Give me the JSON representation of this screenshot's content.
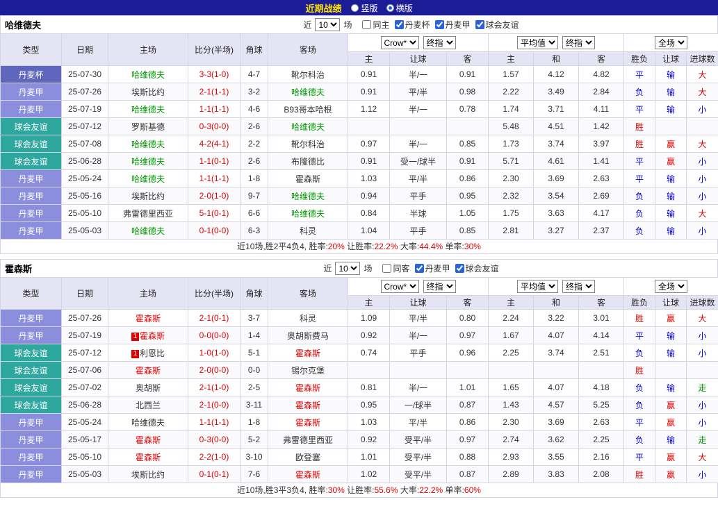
{
  "topbar": {
    "title": "近期战绩",
    "options": [
      {
        "label": "竖版",
        "selected": false
      },
      {
        "label": "横版",
        "selected": true
      }
    ]
  },
  "league_colors": {
    "丹麦杯": "#5F66BE",
    "丹麦甲": "#8A8EDC",
    "球会友谊": "#2EA89F"
  },
  "tables": [
    {
      "team": "哈维德夫",
      "filter": {
        "near_label": "近",
        "count": "10",
        "games_label": "场",
        "checkboxes": [
          {
            "label": "同主",
            "checked": false
          },
          {
            "label": "丹麦杯",
            "checked": true
          },
          {
            "label": "丹麦甲",
            "checked": true
          },
          {
            "label": "球会友谊",
            "checked": true
          }
        ]
      },
      "dropdowns": {
        "bookmaker": "Crow*",
        "bookmaker_stage": "终指",
        "average": "平均值",
        "average_stage": "终指",
        "scope": "全场"
      },
      "columns": [
        "类型",
        "日期",
        "主场",
        "比分(半场)",
        "角球",
        "客场",
        "主",
        "让球",
        "客",
        "主",
        "和",
        "客",
        "胜负",
        "让球",
        "进球数"
      ],
      "rows": [
        {
          "league": "丹麦杯",
          "date": "25-07-30",
          "home": "哈维德夫",
          "home_color": "green",
          "score": "3-3(1-0)",
          "corner": "4-7",
          "away": "靴尔科治",
          "away_color": "black",
          "odds": [
            "0.91",
            "半/一",
            "0.91"
          ],
          "avg": [
            "1.57",
            "4.12",
            "4.82"
          ],
          "results": [
            [
              "平",
              "blue"
            ],
            [
              "输",
              "blue"
            ],
            [
              "大",
              "red"
            ]
          ]
        },
        {
          "league": "丹麦甲",
          "date": "25-07-26",
          "home": "埃斯比约",
          "home_color": "black",
          "score": "2-1(1-1)",
          "corner": "3-2",
          "away": "哈维德夫",
          "away_color": "green",
          "odds": [
            "0.91",
            "平/半",
            "0.98"
          ],
          "avg": [
            "2.22",
            "3.49",
            "2.84"
          ],
          "results": [
            [
              "负",
              "blue"
            ],
            [
              "输",
              "blue"
            ],
            [
              "大",
              "red"
            ]
          ]
        },
        {
          "league": "丹麦甲",
          "date": "25-07-19",
          "home": "哈维德夫",
          "home_color": "green",
          "score": "1-1(1-1)",
          "corner": "4-6",
          "away": "B93哥本哈根",
          "away_color": "black",
          "odds": [
            "1.12",
            "半/一",
            "0.78"
          ],
          "avg": [
            "1.74",
            "3.71",
            "4.11"
          ],
          "results": [
            [
              "平",
              "blue"
            ],
            [
              "输",
              "blue"
            ],
            [
              "小",
              "blue"
            ]
          ]
        },
        {
          "league": "球会友谊",
          "date": "25-07-12",
          "home": "罗斯基德",
          "home_color": "black",
          "score": "0-3(0-0)",
          "corner": "2-6",
          "away": "哈维德夫",
          "away_color": "green",
          "odds": [
            "",
            "",
            ""
          ],
          "avg": [
            "5.48",
            "4.51",
            "1.42"
          ],
          "results": [
            [
              "胜",
              "red"
            ],
            [
              "",
              "black"
            ],
            [
              "",
              "black"
            ]
          ]
        },
        {
          "league": "球会友谊",
          "date": "25-07-08",
          "home": "哈维德夫",
          "home_color": "green",
          "score": "4-2(4-1)",
          "corner": "2-2",
          "away": "靴尔科治",
          "away_color": "black",
          "odds": [
            "0.97",
            "半/一",
            "0.85"
          ],
          "avg": [
            "1.73",
            "3.74",
            "3.97"
          ],
          "results": [
            [
              "胜",
              "red"
            ],
            [
              "赢",
              "red"
            ],
            [
              "大",
              "red"
            ]
          ]
        },
        {
          "league": "球会友谊",
          "date": "25-06-28",
          "home": "哈维德夫",
          "home_color": "green",
          "score": "1-1(0-1)",
          "corner": "2-6",
          "away": "布隆德比",
          "away_color": "black",
          "odds": [
            "0.91",
            "受一/球半",
            "0.91"
          ],
          "avg": [
            "5.71",
            "4.61",
            "1.41"
          ],
          "results": [
            [
              "平",
              "blue"
            ],
            [
              "赢",
              "red"
            ],
            [
              "小",
              "blue"
            ]
          ]
        },
        {
          "league": "丹麦甲",
          "date": "25-05-24",
          "home": "哈维德夫",
          "home_color": "green",
          "score": "1-1(1-1)",
          "corner": "1-8",
          "away": "霍森斯",
          "away_color": "black",
          "odds": [
            "1.03",
            "平/半",
            "0.86"
          ],
          "avg": [
            "2.30",
            "3.69",
            "2.63"
          ],
          "results": [
            [
              "平",
              "blue"
            ],
            [
              "输",
              "blue"
            ],
            [
              "小",
              "blue"
            ]
          ]
        },
        {
          "league": "丹麦甲",
          "date": "25-05-16",
          "home": "埃斯比约",
          "home_color": "black",
          "score": "2-0(1-0)",
          "corner": "9-7",
          "away": "哈维德夫",
          "away_color": "green",
          "odds": [
            "0.94",
            "平手",
            "0.95"
          ],
          "avg": [
            "2.32",
            "3.54",
            "2.69"
          ],
          "results": [
            [
              "负",
              "blue"
            ],
            [
              "输",
              "blue"
            ],
            [
              "小",
              "blue"
            ]
          ]
        },
        {
          "league": "丹麦甲",
          "date": "25-05-10",
          "home": "弗雷德里西亚",
          "home_color": "black",
          "score": "5-1(0-1)",
          "corner": "6-6",
          "away": "哈维德夫",
          "away_color": "green",
          "odds": [
            "0.84",
            "半球",
            "1.05"
          ],
          "avg": [
            "1.75",
            "3.63",
            "4.17"
          ],
          "results": [
            [
              "负",
              "blue"
            ],
            [
              "输",
              "blue"
            ],
            [
              "大",
              "red"
            ]
          ]
        },
        {
          "league": "丹麦甲",
          "date": "25-05-03",
          "home": "哈维德夫",
          "home_color": "green",
          "score": "0-1(0-0)",
          "corner": "6-3",
          "away": "科灵",
          "away_color": "black",
          "odds": [
            "1.04",
            "平手",
            "0.85"
          ],
          "avg": [
            "2.81",
            "3.27",
            "2.37"
          ],
          "results": [
            [
              "负",
              "blue"
            ],
            [
              "输",
              "blue"
            ],
            [
              "小",
              "blue"
            ]
          ]
        }
      ],
      "summary": [
        {
          "t": "近10场,胜2平4负4, ",
          "c": "black"
        },
        {
          "t": "胜率:",
          "c": "black"
        },
        {
          "t": "20%",
          "c": "red"
        },
        {
          "t": " 让胜率:",
          "c": "black"
        },
        {
          "t": "22.2%",
          "c": "red"
        },
        {
          "t": " 大率:",
          "c": "black"
        },
        {
          "t": "44.4%",
          "c": "red"
        },
        {
          "t": " 单率:",
          "c": "black"
        },
        {
          "t": "30%",
          "c": "red"
        }
      ]
    },
    {
      "team": "霍森斯",
      "filter": {
        "near_label": "近",
        "count": "10",
        "games_label": "场",
        "checkboxes": [
          {
            "label": "同客",
            "checked": false
          },
          {
            "label": "丹麦甲",
            "checked": true
          },
          {
            "label": "球会友谊",
            "checked": true
          }
        ]
      },
      "dropdowns": {
        "bookmaker": "Crow*",
        "bookmaker_stage": "终指",
        "average": "平均值",
        "average_stage": "终指",
        "scope": "全场"
      },
      "columns": [
        "类型",
        "日期",
        "主场",
        "比分(半场)",
        "角球",
        "客场",
        "主",
        "让球",
        "客",
        "主",
        "和",
        "客",
        "胜负",
        "让球",
        "进球数"
      ],
      "rows": [
        {
          "league": "丹麦甲",
          "date": "25-07-26",
          "home": "霍森斯",
          "home_color": "red",
          "score": "2-1(0-1)",
          "corner": "3-7",
          "away": "科灵",
          "away_color": "black",
          "odds": [
            "1.09",
            "平/半",
            "0.80"
          ],
          "avg": [
            "2.24",
            "3.22",
            "3.01"
          ],
          "results": [
            [
              "胜",
              "red"
            ],
            [
              "赢",
              "red"
            ],
            [
              "大",
              "red"
            ]
          ]
        },
        {
          "league": "丹麦甲",
          "date": "25-07-19",
          "home": "霍森斯",
          "home_color": "red",
          "home_badge": "1",
          "score": "0-0(0-0)",
          "corner": "1-4",
          "away": "奥胡斯费马",
          "away_color": "black",
          "odds": [
            "0.92",
            "半/一",
            "0.97"
          ],
          "avg": [
            "1.67",
            "4.07",
            "4.14"
          ],
          "results": [
            [
              "平",
              "blue"
            ],
            [
              "输",
              "blue"
            ],
            [
              "小",
              "blue"
            ]
          ]
        },
        {
          "league": "球会友谊",
          "date": "25-07-12",
          "home": "利恩比",
          "home_color": "black",
          "home_badge": "1",
          "score": "1-0(1-0)",
          "corner": "5-1",
          "away": "霍森斯",
          "away_color": "red",
          "odds": [
            "0.74",
            "平手",
            "0.96"
          ],
          "avg": [
            "2.25",
            "3.74",
            "2.51"
          ],
          "results": [
            [
              "负",
              "blue"
            ],
            [
              "输",
              "blue"
            ],
            [
              "小",
              "blue"
            ]
          ]
        },
        {
          "league": "球会友谊",
          "date": "25-07-06",
          "home": "霍森斯",
          "home_color": "red",
          "score": "2-0(0-0)",
          "corner": "0-0",
          "away": "锡尔克堡",
          "away_color": "black",
          "odds": [
            "",
            "",
            ""
          ],
          "avg": [
            "",
            "",
            ""
          ],
          "results": [
            [
              "胜",
              "red"
            ],
            [
              "",
              "black"
            ],
            [
              "",
              "black"
            ]
          ]
        },
        {
          "league": "球会友谊",
          "date": "25-07-02",
          "home": "奥胡斯",
          "home_color": "black",
          "score": "2-1(1-0)",
          "corner": "2-5",
          "away": "霍森斯",
          "away_color": "red",
          "odds": [
            "0.81",
            "半/一",
            "1.01"
          ],
          "avg": [
            "1.65",
            "4.07",
            "4.18"
          ],
          "results": [
            [
              "负",
              "blue"
            ],
            [
              "输",
              "blue"
            ],
            [
              "走",
              "green"
            ]
          ]
        },
        {
          "league": "球会友谊",
          "date": "25-06-28",
          "home": "北西兰",
          "home_color": "black",
          "score": "2-1(0-0)",
          "corner": "3-11",
          "away": "霍森斯",
          "away_color": "red",
          "odds": [
            "0.95",
            "一/球半",
            "0.87"
          ],
          "avg": [
            "1.43",
            "4.57",
            "5.25"
          ],
          "results": [
            [
              "负",
              "blue"
            ],
            [
              "赢",
              "red"
            ],
            [
              "小",
              "blue"
            ]
          ]
        },
        {
          "league": "丹麦甲",
          "date": "25-05-24",
          "home": "哈维德夫",
          "home_color": "black",
          "score": "1-1(1-1)",
          "corner": "1-8",
          "away": "霍森斯",
          "away_color": "red",
          "odds": [
            "1.03",
            "平/半",
            "0.86"
          ],
          "avg": [
            "2.30",
            "3.69",
            "2.63"
          ],
          "results": [
            [
              "平",
              "blue"
            ],
            [
              "赢",
              "red"
            ],
            [
              "小",
              "blue"
            ]
          ]
        },
        {
          "league": "丹麦甲",
          "date": "25-05-17",
          "home": "霍森斯",
          "home_color": "red",
          "score": "0-3(0-0)",
          "corner": "5-2",
          "away": "弗雷德里西亚",
          "away_color": "black",
          "odds": [
            "0.92",
            "受平/半",
            "0.97"
          ],
          "avg": [
            "2.74",
            "3.62",
            "2.25"
          ],
          "results": [
            [
              "负",
              "blue"
            ],
            [
              "输",
              "blue"
            ],
            [
              "走",
              "green"
            ]
          ]
        },
        {
          "league": "丹麦甲",
          "date": "25-05-10",
          "home": "霍森斯",
          "home_color": "red",
          "score": "2-2(1-0)",
          "corner": "3-10",
          "away": "欧登塞",
          "away_color": "black",
          "odds": [
            "1.01",
            "受平/半",
            "0.88"
          ],
          "avg": [
            "2.93",
            "3.55",
            "2.16"
          ],
          "results": [
            [
              "平",
              "blue"
            ],
            [
              "赢",
              "red"
            ],
            [
              "大",
              "red"
            ]
          ]
        },
        {
          "league": "丹麦甲",
          "date": "25-05-03",
          "home": "埃斯比约",
          "home_color": "black",
          "score": "0-1(0-1)",
          "corner": "7-6",
          "away": "霍森斯",
          "away_color": "red",
          "odds": [
            "1.02",
            "受平/半",
            "0.87"
          ],
          "avg": [
            "2.89",
            "3.83",
            "2.08"
          ],
          "results": [
            [
              "胜",
              "red"
            ],
            [
              "赢",
              "red"
            ],
            [
              "小",
              "blue"
            ]
          ]
        }
      ],
      "summary": [
        {
          "t": "近10场,胜3平3负4, ",
          "c": "black"
        },
        {
          "t": "胜率:",
          "c": "black"
        },
        {
          "t": "30%",
          "c": "red"
        },
        {
          "t": " 让胜率:",
          "c": "black"
        },
        {
          "t": "55.6%",
          "c": "red"
        },
        {
          "t": " 大率:",
          "c": "black"
        },
        {
          "t": "22.2%",
          "c": "red"
        },
        {
          "t": " 单率:",
          "c": "black"
        },
        {
          "t": "60%",
          "c": "red"
        }
      ]
    }
  ]
}
